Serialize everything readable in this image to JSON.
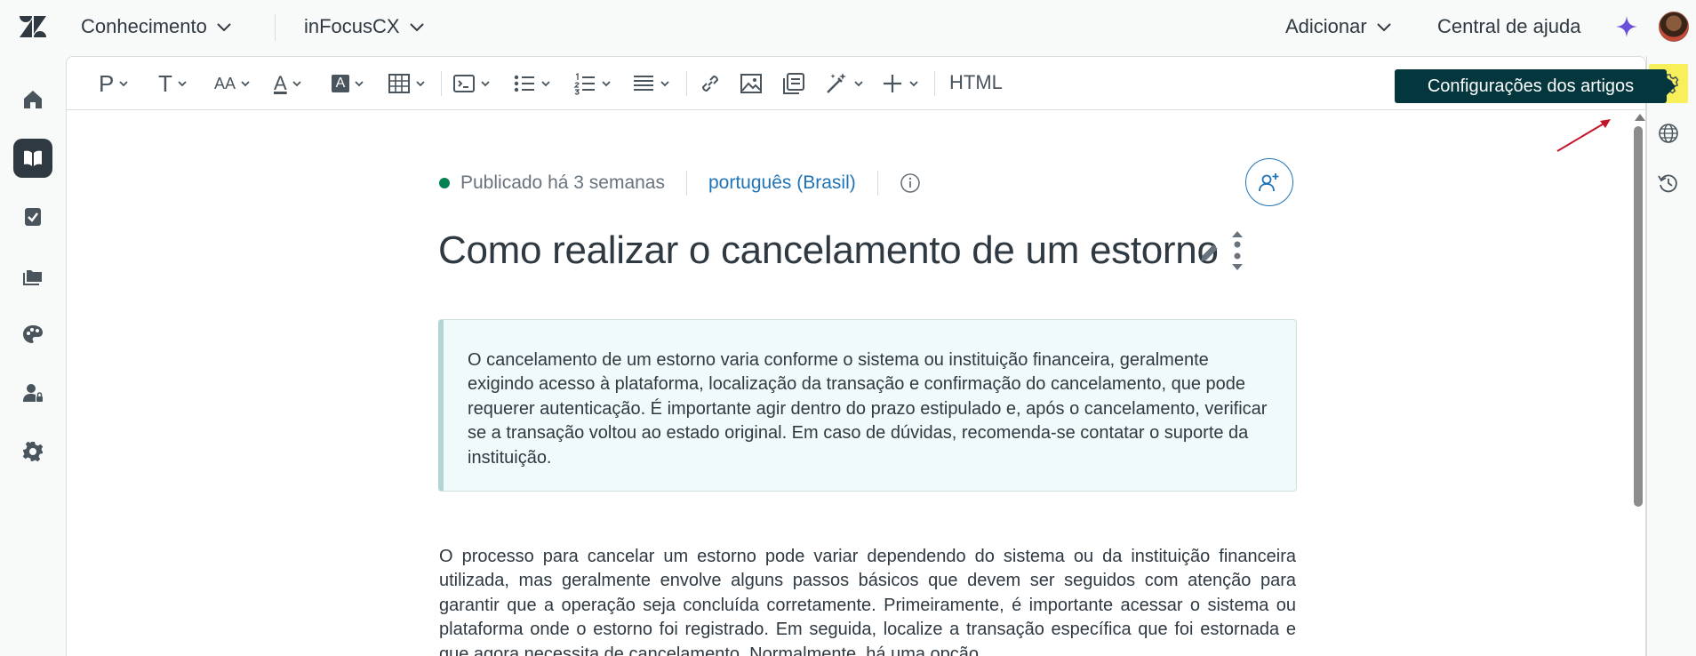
{
  "header": {
    "product_label": "Conhecimento",
    "brand_label": "inFocusCX",
    "add_label": "Adicionar",
    "help_center_label": "Central de ajuda"
  },
  "toolbar": {
    "paragraph_glyph": "P",
    "heading_glyph": "T",
    "font_size_glyph": "AA",
    "text_color_glyph": "A",
    "highlight_glyph": "A",
    "html_label": "HTML"
  },
  "article": {
    "status": "Publicado há 3 semanas",
    "language": "português (Brasil)",
    "title": "Como realizar o cancelamento de um estorno",
    "callout_text": "O cancelamento de um estorno varia conforme o sistema ou instituição financeira, geralmente exigindo acesso à plataforma, localização da transação e confirmação do cancelamento, que pode requerer autenticação. É importante agir dentro do prazo estipulado e, após o cancelamento, verificar se a transação voltou ao estado original. Em caso de dúvidas, recomenda-se contatar o suporte da instituição.",
    "body_text": "O processo para cancelar um estorno pode variar dependendo do sistema ou da instituição financeira utilizada, mas geralmente envolve alguns passos básicos que devem ser seguidos com atenção para garantir que a operação seja concluída corretamente. Primeiramente, é importante acessar o sistema ou plataforma onde o estorno foi registrado. Em seguida, localize a transação específica que foi estornada e que agora necessita de cancelamento. Normalmente, há uma opção"
  },
  "tooltip": {
    "text": "Configurações dos artigos"
  },
  "colors": {
    "status_dot": "#038153",
    "link_blue": "#1f73b7",
    "tooltip_bg": "#03363d",
    "highlight_yellow": "#f7f05a",
    "annotation_red": "#c4162a"
  }
}
